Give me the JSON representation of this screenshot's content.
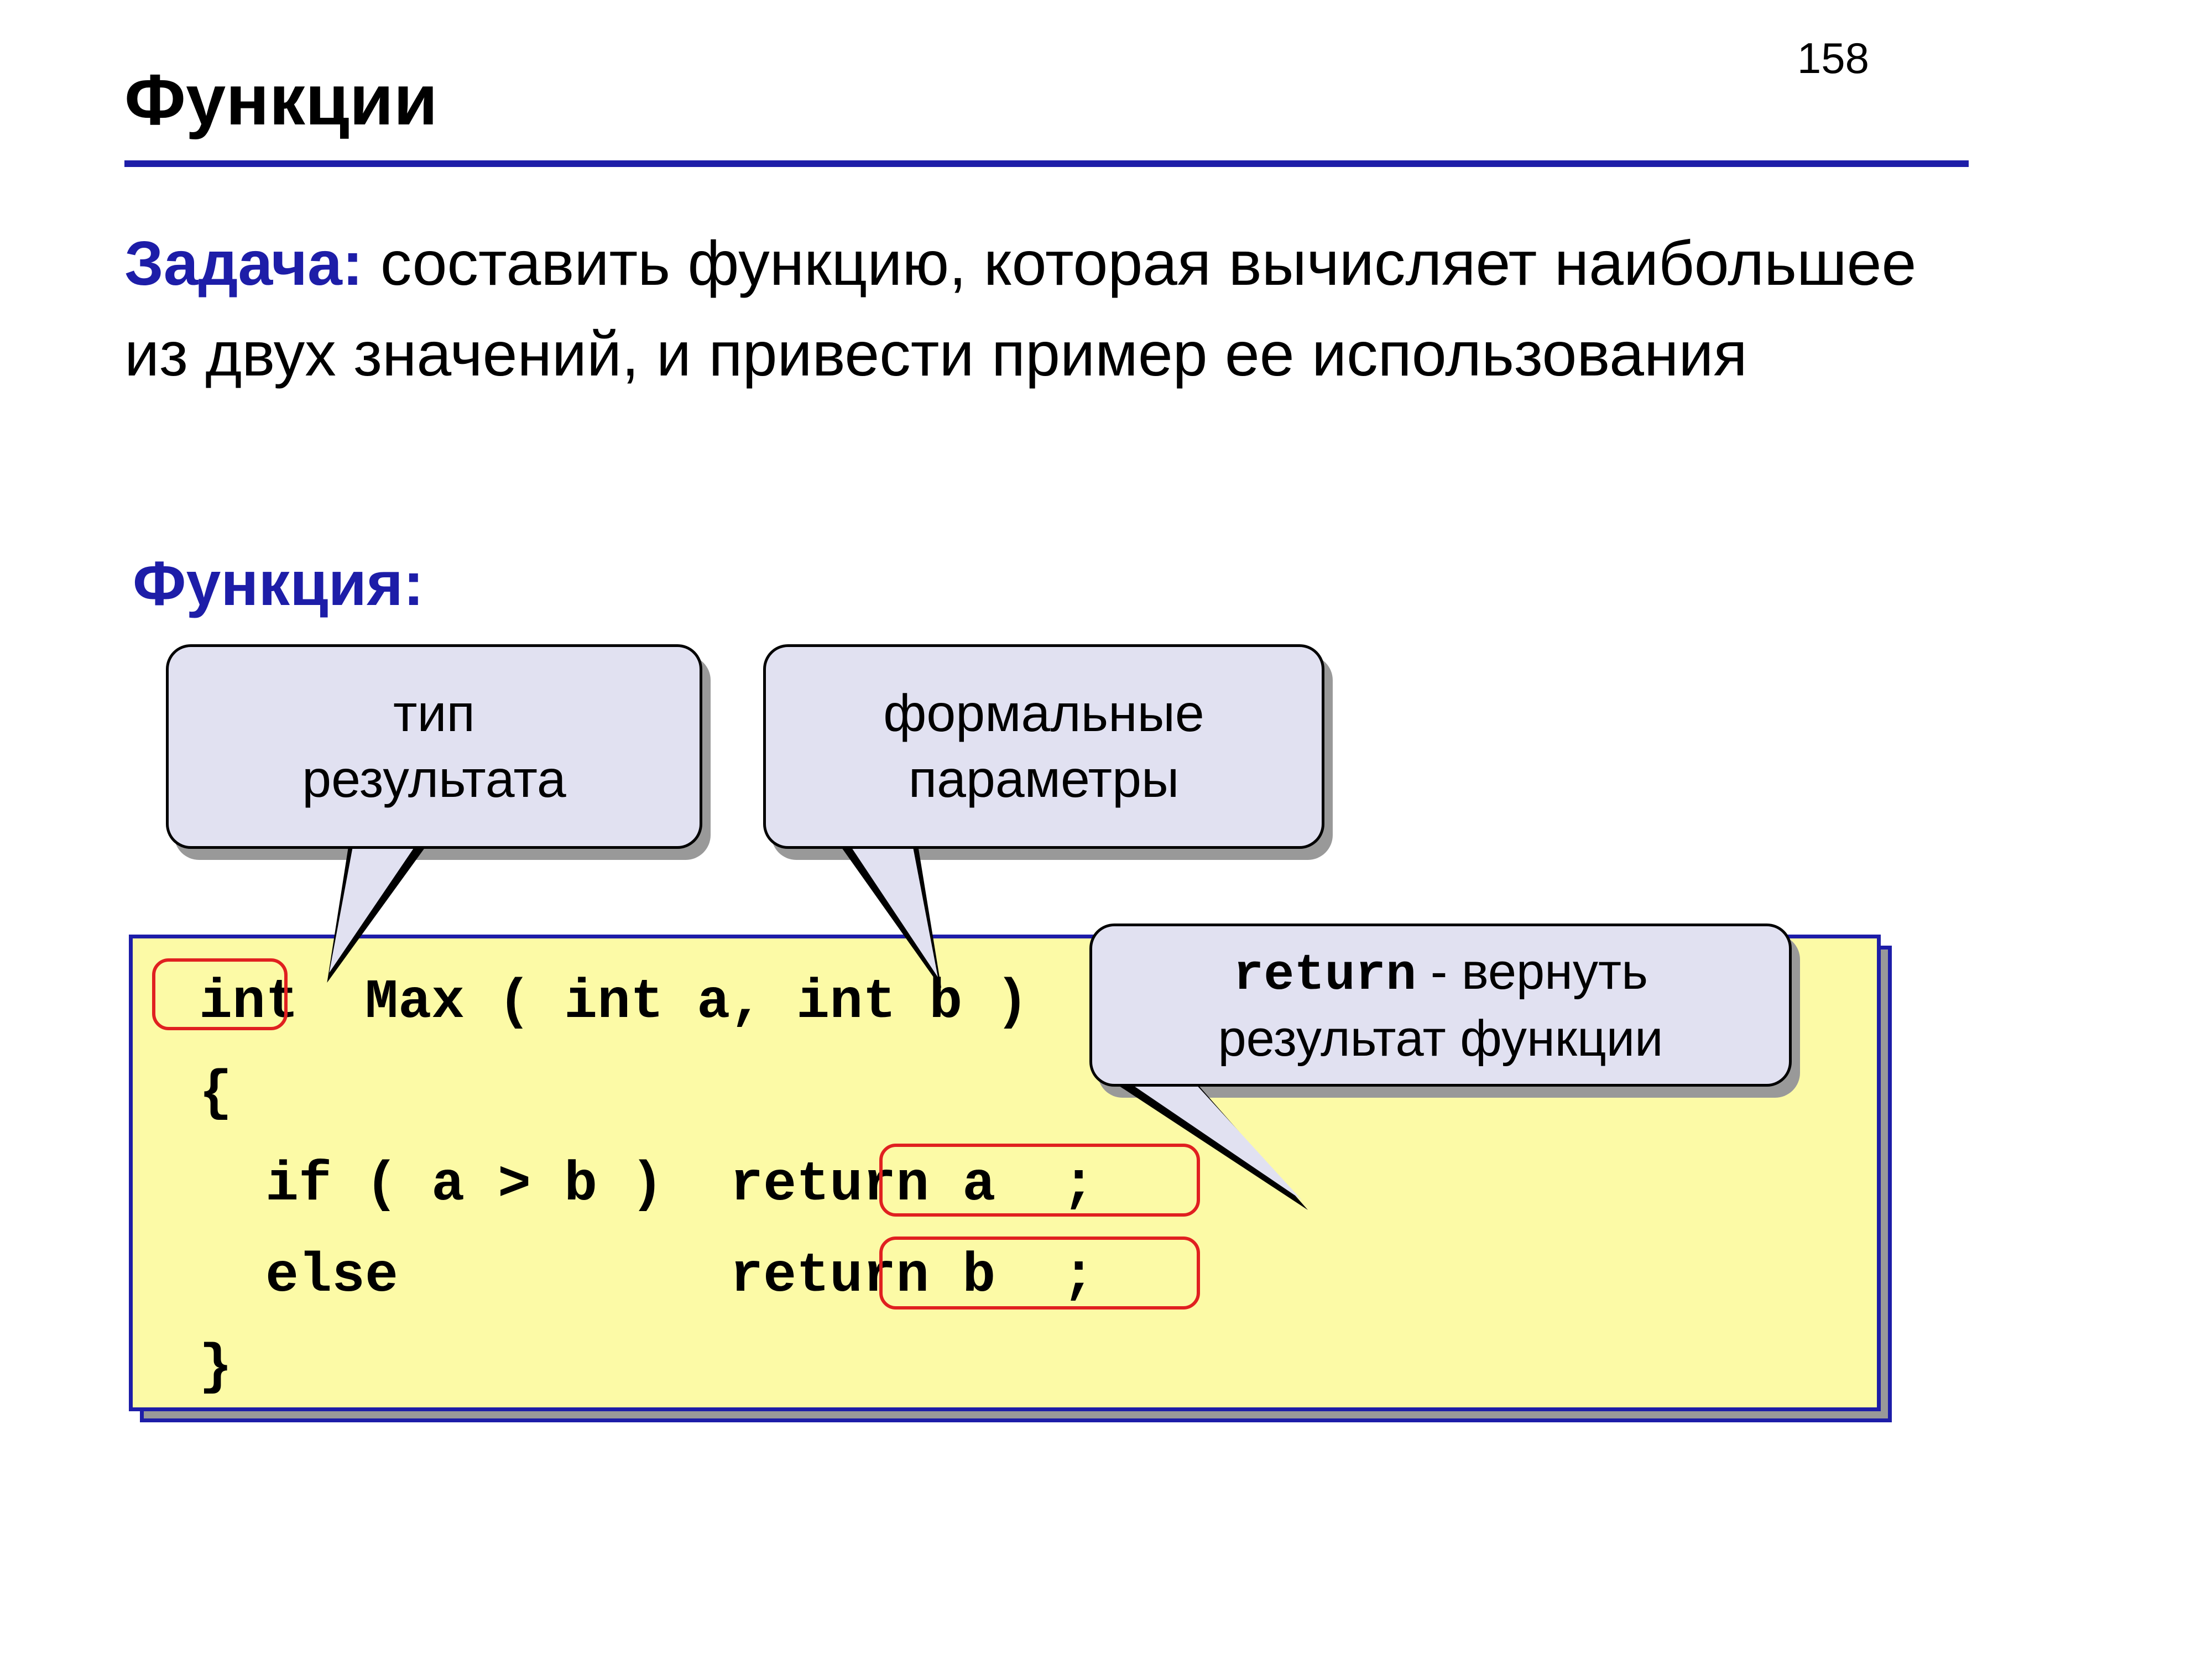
{
  "page_number": "158",
  "title": "Функции",
  "task": {
    "label": "Задача:",
    "text": " составить функцию, которая вычисляет наибольшее из двух значений, и привести пример ее использования"
  },
  "function_label": "Функция:",
  "callouts": {
    "result_type_l1": "тип",
    "result_type_l2": "результата",
    "formal_params_l1": "формальные",
    "formal_params_l2": "параметры",
    "return_kw": "return",
    "return_rest": " - вернуть",
    "return_l2": "результат функции"
  },
  "code": {
    "l1": " int  Max ( int a, int b )",
    "l2": " {",
    "l3": "   if ( a > b )  return a  ;",
    "l4": "   else          return b  ;",
    "l5": " }"
  }
}
